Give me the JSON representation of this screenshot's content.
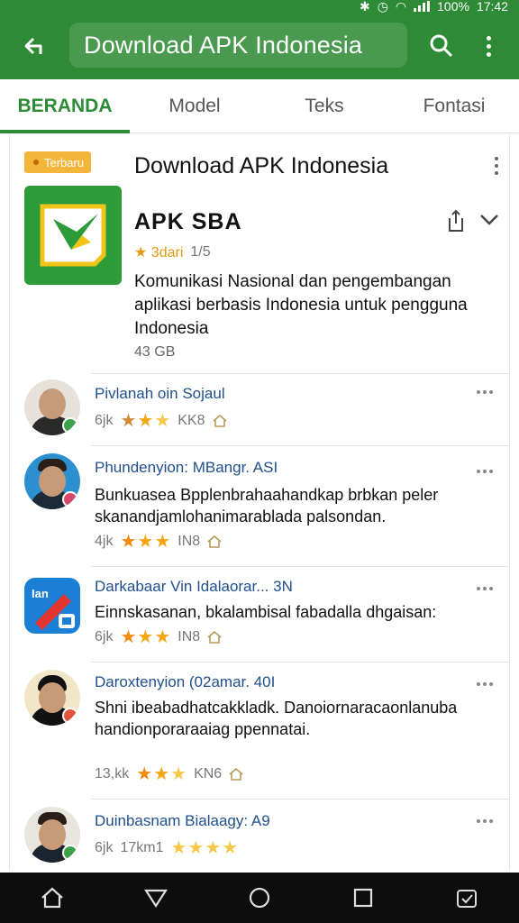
{
  "status_bar": {
    "battery": "100%",
    "time": "17:42"
  },
  "header": {
    "title": "Download APK Indonesia"
  },
  "tabs": [
    {
      "label": "BERANDA",
      "active": true
    },
    {
      "label": "Model",
      "active": false
    },
    {
      "label": "Teks",
      "active": false
    },
    {
      "label": "Fontasi",
      "active": false
    }
  ],
  "featured": {
    "badge": "Terbaru",
    "heading": "Download APK Indonesia",
    "app_name": "APK SBA",
    "rating": "★ 3dari",
    "reviews": "1/5",
    "description": "Komunikasi Nasional dan pengembangan aplikasi berbasis Indonesia untuk pengguna Indonesia",
    "size": "43 GB"
  },
  "comments": [
    {
      "author": "Pivlanah oin Sojaul",
      "text": "",
      "meta": "6jk",
      "rating": 2.5,
      "count": "KK8"
    },
    {
      "author": "Phundenyion: MBangr. ASI",
      "text": "Bunkuasea Bpplenbrahaahandkap brbkan peler skanandjamlohanimarablada palsondan.",
      "meta": "4jk",
      "rating": 3,
      "count": "IN8"
    },
    {
      "author": "Darkabaar Vin Idalaorar... 3N",
      "text": "Einnskasanan, bkalambisal fabadalla dhgaisan:",
      "meta": "6jk",
      "rating": 3,
      "count": "IN8"
    },
    {
      "author": "Daroxtenyion (02amar. 40I",
      "text": "Shni ibeabadhatcakkladk. Danoiornaracaonlanuba handionporaraaiag ppennatai.",
      "meta": "13,kk",
      "rating": 3,
      "count": "KN6"
    },
    {
      "author": "Duinbasnam Bialaagy: A9",
      "text": "",
      "meta": "6jk",
      "rating": 4,
      "count": "17km1"
    }
  ],
  "colors": {
    "brand_green": "#2e8b35",
    "star": "#f4a712",
    "link_blue": "#1f4f8c"
  }
}
